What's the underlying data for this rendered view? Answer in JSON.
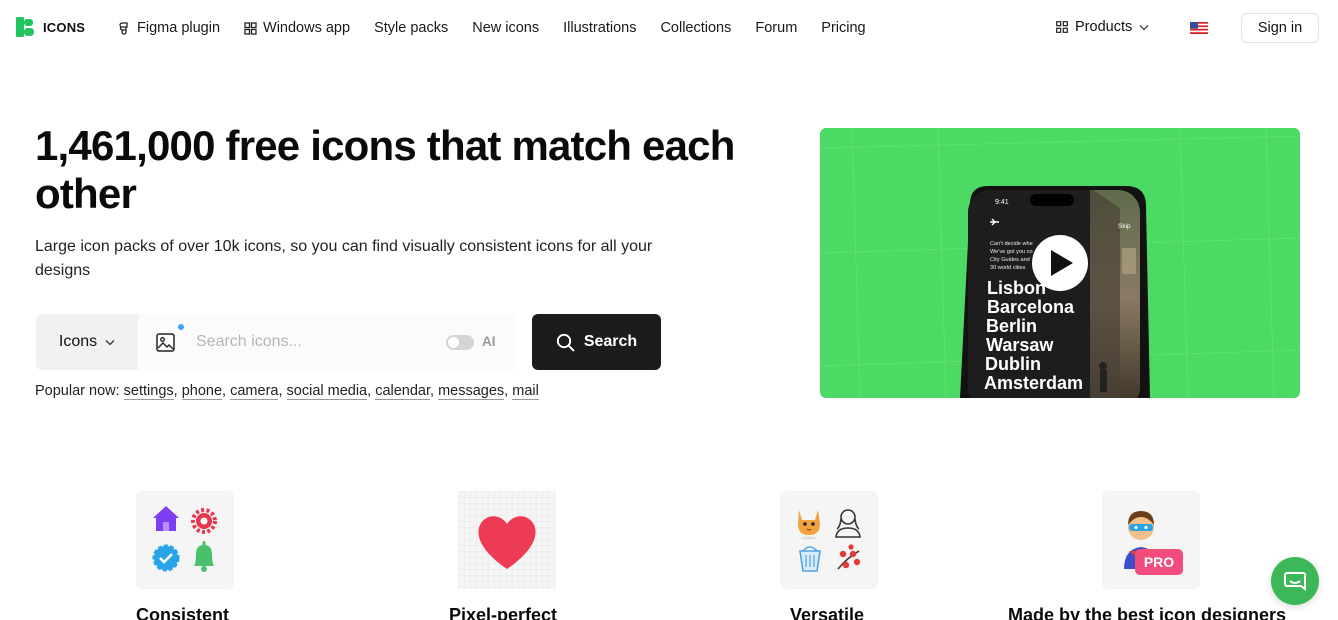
{
  "header": {
    "logo_text": "ICONS",
    "nav": [
      {
        "label": "Figma plugin",
        "icon": "figma-icon"
      },
      {
        "label": "Windows app",
        "icon": "windows-icon"
      },
      {
        "label": "Style packs"
      },
      {
        "label": "New icons"
      },
      {
        "label": "Illustrations"
      },
      {
        "label": "Collections"
      },
      {
        "label": "Forum"
      },
      {
        "label": "Pricing"
      }
    ],
    "products_label": "Products",
    "language_flag": "us-flag-icon",
    "signin_label": "Sign in"
  },
  "hero": {
    "title": "1,461,000 free icons that match each other",
    "subtitle": "Large icon packs of over 10k icons, so you can find visually consistent icons for all your designs"
  },
  "search": {
    "type_label": "Icons",
    "placeholder": "Search icons...",
    "ai_label": "AI",
    "ai_enabled": false,
    "button_label": "Search"
  },
  "popular": {
    "label": "Popular now:",
    "items": [
      "settings",
      "phone",
      "camera",
      "social media",
      "calendar",
      "messages",
      "mail"
    ]
  },
  "video": {
    "phone_time": "9:41",
    "skip_label": "Skip",
    "intro_lines": [
      "Can't decide whe",
      "We've got you co",
      "City Guides and",
      "30 world cities"
    ],
    "cities": [
      "Lisbon",
      "Barcelona",
      "Berlin",
      "Warsaw",
      "Dublin",
      "Amsterdam"
    ],
    "background_color": "#4cd964"
  },
  "features": [
    {
      "title": "Consistent",
      "icons": [
        "house-icon",
        "gear-icon",
        "verified-badge-icon",
        "bell-icon"
      ]
    },
    {
      "title": "Pixel-perfect",
      "icons": [
        "heart-icon"
      ]
    },
    {
      "title": "Versatile",
      "icons": [
        "cat-icon",
        "person-outline-icon",
        "basket-icon",
        "cherry-blossom-icon"
      ]
    },
    {
      "title": "Made by the best icon designers",
      "icons": [
        "superhero-icon"
      ],
      "badge": "PRO"
    }
  ],
  "colors": {
    "brand_green": "#22c55e",
    "search_button": "#1c1c1c",
    "chat_button": "#3db858"
  }
}
